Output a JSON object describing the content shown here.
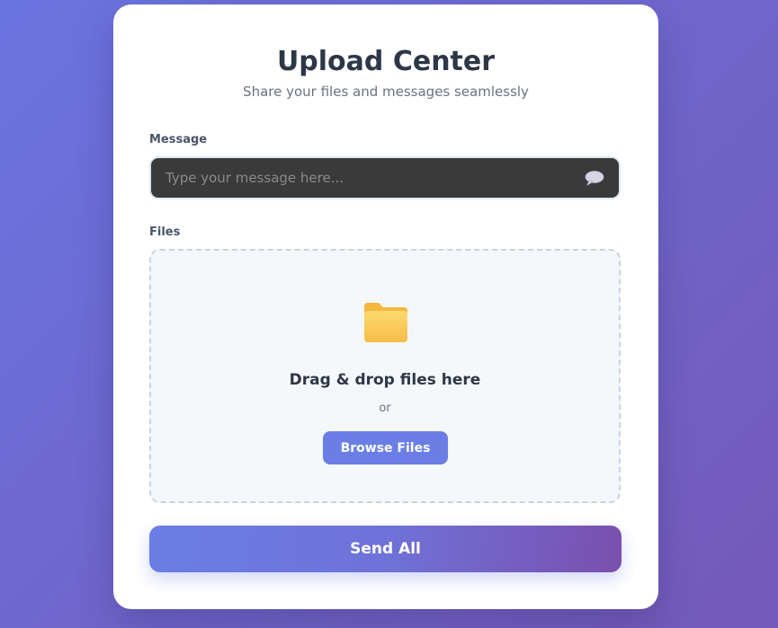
{
  "header": {
    "title": "Upload Center",
    "subtitle": "Share your files and messages seamlessly"
  },
  "message": {
    "label": "Message",
    "placeholder": "Type your message here...",
    "value": "",
    "icon": "speech-bubble-icon"
  },
  "files": {
    "label": "Files",
    "icon": "folder-icon",
    "drop_text": "Drag & drop files here",
    "or_text": "or",
    "browse_label": "Browse Files"
  },
  "actions": {
    "send_label": "Send All"
  },
  "colors": {
    "background_start": "#6a74e0",
    "background_end": "#7459b8",
    "accent": "#6a7ee6",
    "accent_end": "#7a4fae",
    "input_background": "#3a3a3a",
    "dropzone_background": "#f5f8fb"
  }
}
